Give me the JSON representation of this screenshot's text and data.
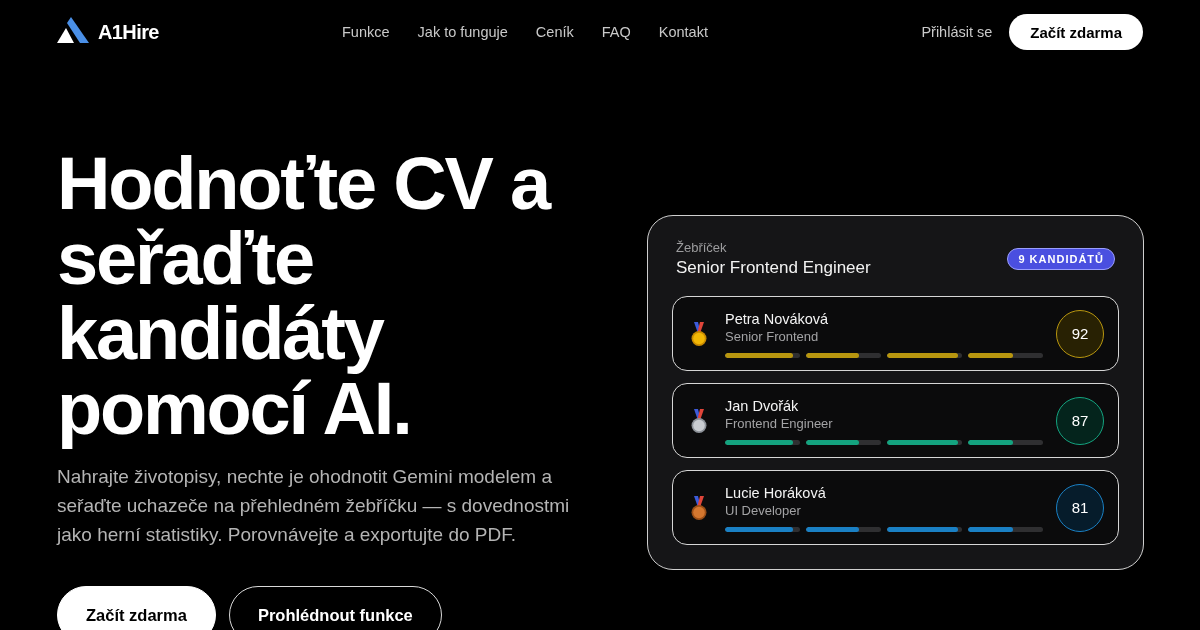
{
  "nav": {
    "logo": "A1Hire",
    "links": [
      "Funkce",
      "Jak to funguje",
      "Ceník",
      "FAQ",
      "Kontakt"
    ],
    "login": "Přihlásit se",
    "cta": "Začít zdarma"
  },
  "hero": {
    "heading": "Hodnoťte CV a seřaďte kandidáty pomocí AI.",
    "text": "Nahrajte životopisy, nechte je ohodnotit Gemini modelem a seřaďte uchazeče na přehledném žebříčku — s dovednostmi jako herní statistiky. Porovnávejte a exportujte do PDF.",
    "buttons": [
      {
        "label": "Začít zdarma",
        "kind": "primary"
      },
      {
        "label": "Prohlédnout funkce",
        "kind": "outline"
      }
    ]
  },
  "leaderboard": {
    "eyebrow": "Žebříček",
    "title": "Senior Frontend Engineer",
    "badge": "9 KANDIDÁTŮ",
    "candidates": [
      {
        "name": "Petra Nováková",
        "role": "Senior Frontend",
        "score": "92",
        "kind": "gold",
        "color": "#b8960f",
        "skills": [
          {
            "level": 0.91
          },
          {
            "level": 0.71
          },
          {
            "level": 0.95
          },
          {
            "level": 0.6
          }
        ]
      },
      {
        "name": "Jan Dvořák",
        "role": "Frontend Engineer",
        "score": "87",
        "kind": "silver",
        "color": "#14a37f",
        "skills": [
          {
            "level": 0.91
          },
          {
            "level": 0.71
          },
          {
            "level": 0.95
          },
          {
            "level": 0.6
          }
        ]
      },
      {
        "name": "Lucie Horáková",
        "role": "UI Developer",
        "score": "81",
        "kind": "bronze",
        "color": "#1a80c4",
        "skills": [
          {
            "level": 0.91
          },
          {
            "level": 0.71
          },
          {
            "level": 0.95
          },
          {
            "level": 0.6
          }
        ]
      }
    ]
  }
}
